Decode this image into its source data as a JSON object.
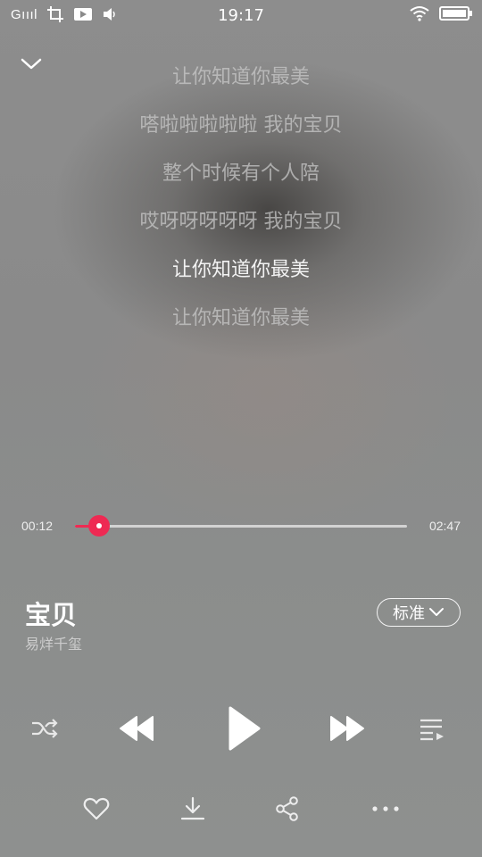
{
  "status_bar": {
    "signal": "Gıııl",
    "time": "19:17"
  },
  "lyrics": {
    "lines": [
      {
        "text": "让你知道你最美",
        "active": false
      },
      {
        "text": "嗒啦啦啦啦啦 我的宝贝",
        "active": false
      },
      {
        "text": "整个时候有个人陪",
        "active": false
      },
      {
        "text": "哎呀呀呀呀呀 我的宝贝",
        "active": false
      },
      {
        "text": "让你知道你最美",
        "active": true
      },
      {
        "text": "让你知道你最美",
        "active": false
      }
    ]
  },
  "player": {
    "current_time": "00:12",
    "total_time": "02:47",
    "progress": 0.072
  },
  "song": {
    "title": "宝贝",
    "artist": "易烊千玺"
  },
  "quality": {
    "label": "标准"
  },
  "colors": {
    "accent": "#ee2a53",
    "background": "#8a8a8a"
  },
  "icons": {
    "collapse": "chevron-down-icon",
    "shuffle": "shuffle-icon",
    "previous": "rewind-icon",
    "play": "play-icon",
    "next": "fast-forward-icon",
    "playlist": "playlist-icon",
    "favorite": "heart-icon",
    "download": "download-icon",
    "share": "share-icon",
    "more": "more-icon"
  }
}
